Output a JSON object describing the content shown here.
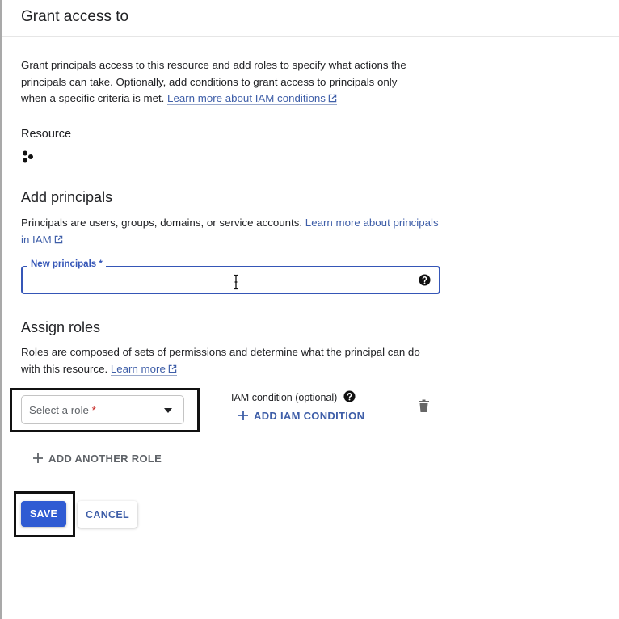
{
  "header": {
    "title": "Grant access to"
  },
  "intro": {
    "text": "Grant principals access to this resource and add roles to specify what actions the principals can take. Optionally, add conditions to grant access to principals only when a specific criteria is met. ",
    "link": "Learn more about IAM conditions"
  },
  "resource": {
    "label": "Resource",
    "icon": "resource-nodes-icon",
    "name": ""
  },
  "add_principals": {
    "title": "Add principals",
    "description": "Principals are users, groups, domains, or service accounts. ",
    "link": "Learn more about principals in IAM",
    "field": {
      "label": "New principals *",
      "value": "",
      "placeholder": ""
    }
  },
  "assign_roles": {
    "title": "Assign roles",
    "description": "Roles are composed of sets of permissions and determine what the principal can do with this resource. ",
    "link": "Learn more",
    "role_select": {
      "placeholder": "Select a role",
      "required_marker": "*",
      "selected": ""
    },
    "condition": {
      "label": "IAM condition (optional)",
      "add_button": "ADD IAM CONDITION"
    },
    "add_another_role": "ADD ANOTHER ROLE"
  },
  "actions": {
    "save": "SAVE",
    "cancel": "CANCEL"
  },
  "colors": {
    "primary": "#2f5bd3",
    "link": "#3e5ea8",
    "focus_border": "#3556b7",
    "required": "#c5221f",
    "highlight_box": "#111111"
  }
}
